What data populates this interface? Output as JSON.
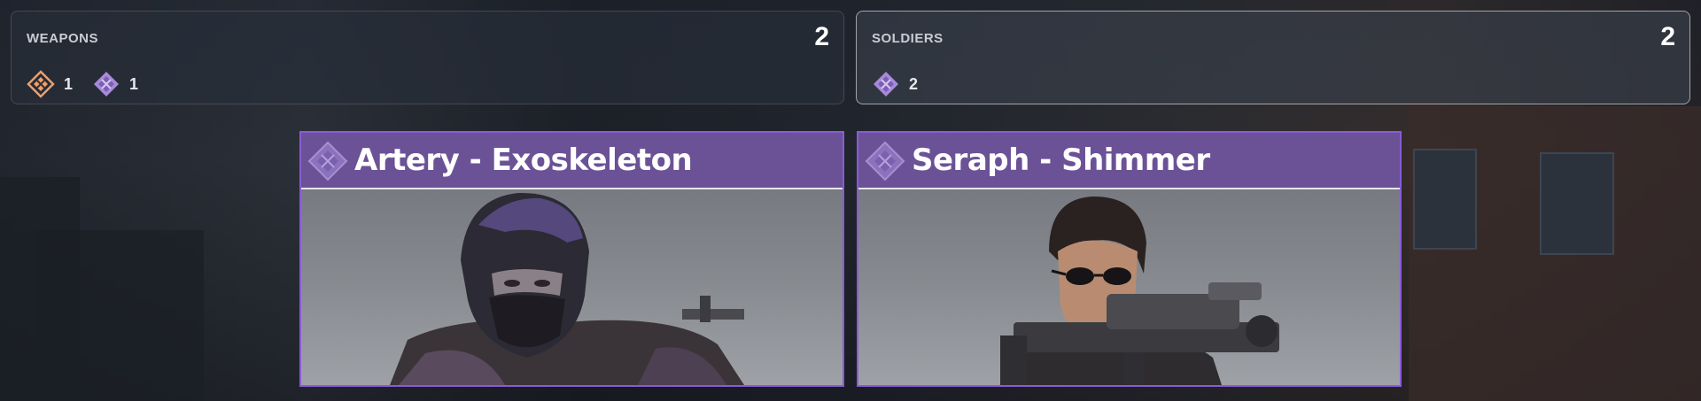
{
  "summary": {
    "weapons": {
      "label": "WEAPONS",
      "count": "2",
      "rarities": [
        {
          "icon": "legendary-gem-icon",
          "color": "#e8a070",
          "count": "1"
        },
        {
          "icon": "epic-gem-icon",
          "color": "#a88ad8",
          "count": "1"
        }
      ]
    },
    "soldiers": {
      "label": "SOLDIERS",
      "count": "2",
      "rarities": [
        {
          "icon": "epic-gem-icon",
          "color": "#a88ad8",
          "count": "2"
        }
      ]
    }
  },
  "cards": [
    {
      "title": "Artery - Exoskeleton",
      "rarity": "epic",
      "accent": "#6b5297"
    },
    {
      "title": "Seraph - Shimmer",
      "rarity": "epic",
      "accent": "#6b5297"
    }
  ]
}
